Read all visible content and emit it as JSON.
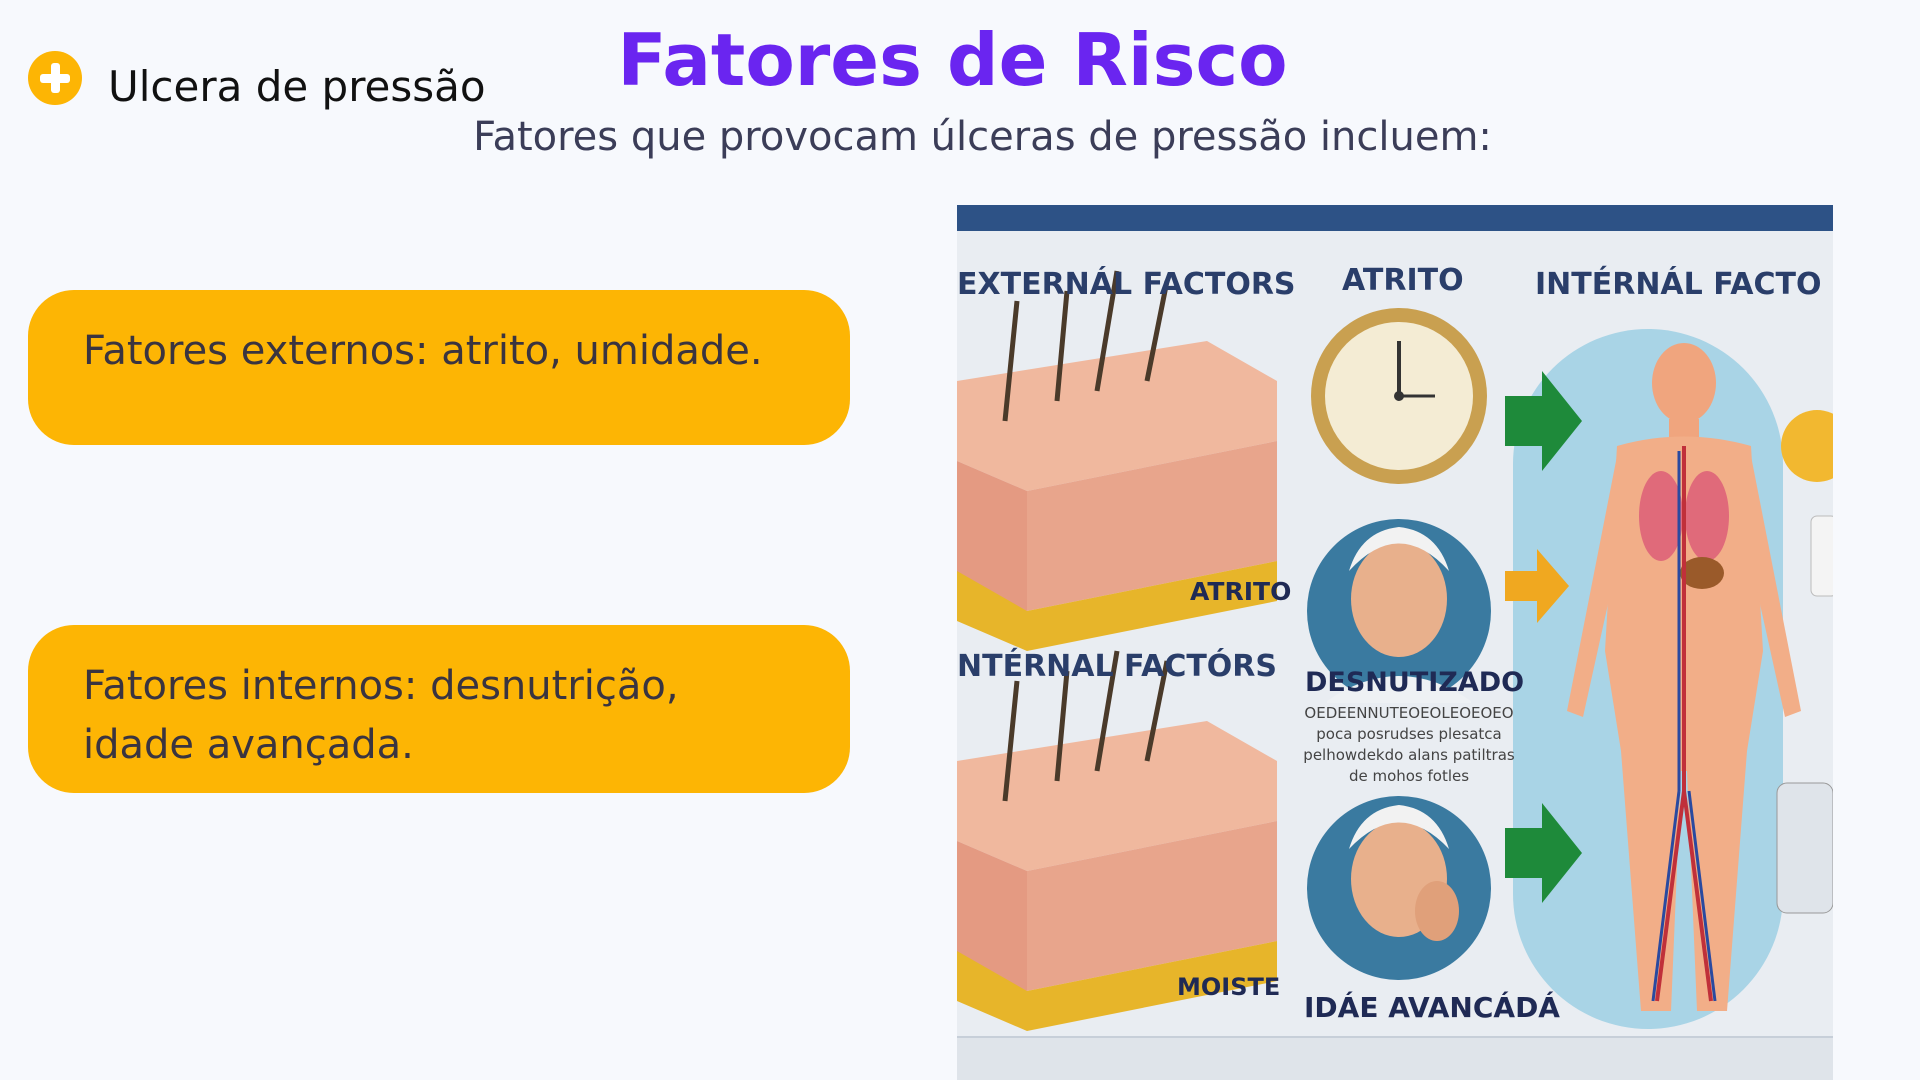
{
  "header": {
    "brand_label": "Ulcera de pressão",
    "title": "Fatores de Risco",
    "subtitle": "Fatores que provocam úlceras de pressão incluem:"
  },
  "cards": [
    {
      "text": "Fatores externos: atrito, umidade."
    },
    {
      "text": "Fatores internos: desnutrição, idade avançada."
    }
  ],
  "infographic": {
    "heading_external": "EXTERNÁL FACTORS",
    "heading_atrito": "ATRITO",
    "heading_internal_right": "INTÉRNÁL FACTO",
    "heading_internal_left": "NTÉRNAL FACTÓRS",
    "label_atrito": "ATRITO",
    "label_desnutrizado": "DESNUTIZADO",
    "caption_lines": [
      "OEDEENNUTEOEOLEOEOEO",
      "poca posrudses plesatca",
      "pelhowdekdo alans patiltras",
      "de mohos fotles"
    ],
    "label_moiste": "MOISTE",
    "label_idade": "IDÁE AVANCÁDÁ"
  },
  "colors": {
    "accent_purple": "#6a25f0",
    "card_yellow": "#fdb504",
    "frame_blue": "#2d5286"
  }
}
